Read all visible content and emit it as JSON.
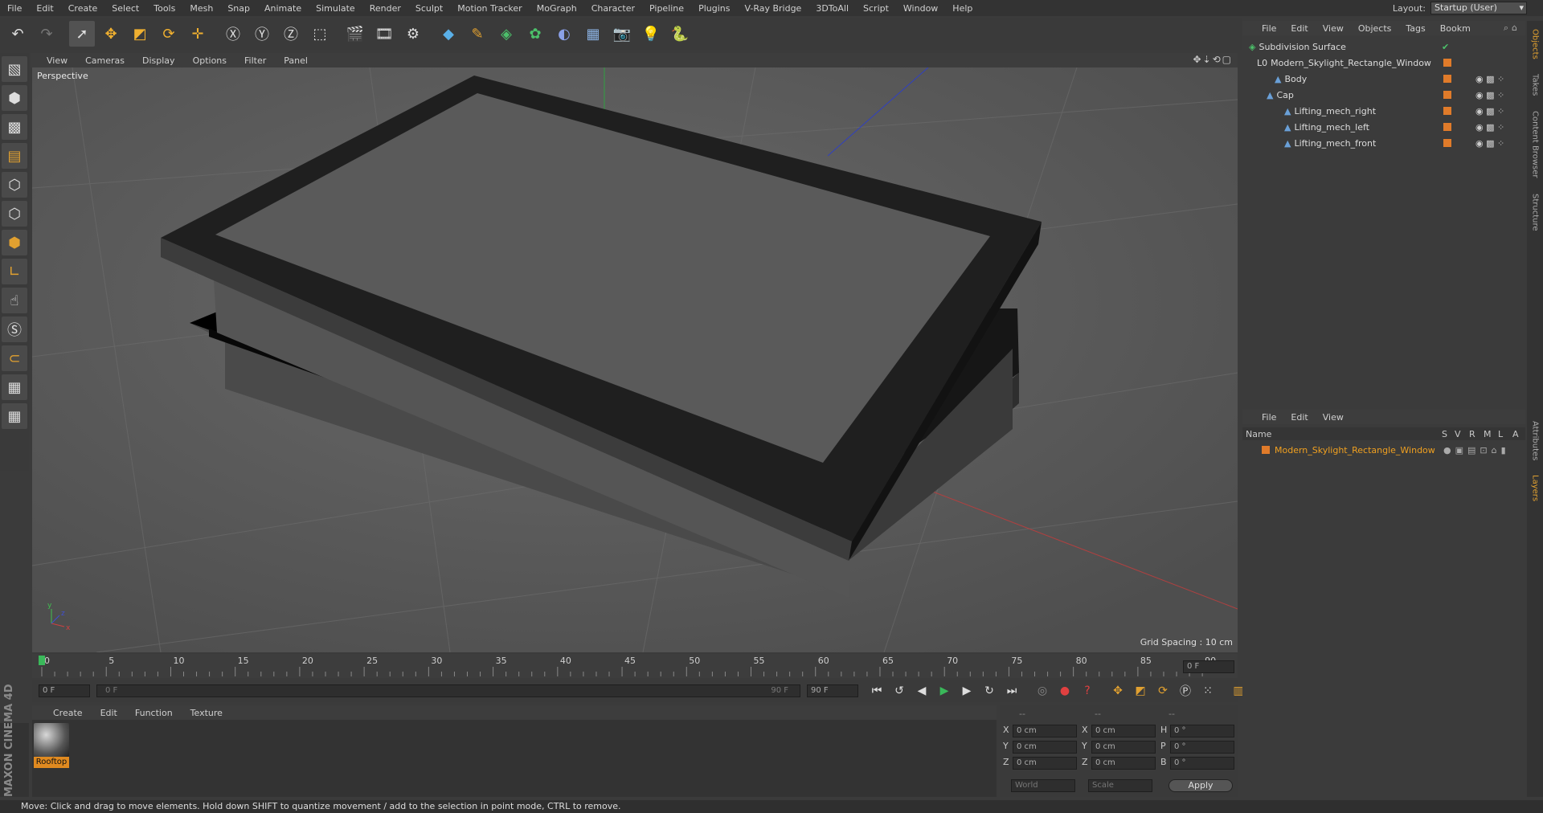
{
  "menubar": {
    "items": [
      "File",
      "Edit",
      "Create",
      "Select",
      "Tools",
      "Mesh",
      "Snap",
      "Animate",
      "Simulate",
      "Render",
      "Sculpt",
      "Motion Tracker",
      "MoGraph",
      "Character",
      "Pipeline",
      "Plugins",
      "V-Ray Bridge",
      "3DToAll",
      "Script",
      "Window",
      "Help"
    ],
    "layout_label": "Layout:",
    "layout_value": "Startup (User)"
  },
  "viewport": {
    "menu": [
      "View",
      "Cameras",
      "Display",
      "Options",
      "Filter",
      "Panel"
    ],
    "label": "Perspective",
    "grid_spacing": "Grid Spacing : 10 cm"
  },
  "timeline": {
    "ticks": [
      "0",
      "5",
      "10",
      "15",
      "20",
      "25",
      "30",
      "35",
      "40",
      "45",
      "50",
      "55",
      "60",
      "65",
      "70",
      "75",
      "80",
      "85",
      "90"
    ],
    "current_frame": "0 F"
  },
  "transport": {
    "start": "0 F",
    "range_start": "0 F",
    "range_end": "90 F",
    "end": "90 F"
  },
  "material_manager": {
    "menu": [
      "Create",
      "Edit",
      "Function",
      "Texture"
    ],
    "material_name": "Rooftop"
  },
  "coords": {
    "headers": [
      "--",
      "--",
      "--"
    ],
    "rows": [
      {
        "a": "X",
        "av": "0 cm",
        "b": "X",
        "bv": "0 cm",
        "c": "H",
        "cv": "0 °"
      },
      {
        "a": "Y",
        "av": "0 cm",
        "b": "Y",
        "bv": "0 cm",
        "c": "P",
        "cv": "0 °"
      },
      {
        "a": "Z",
        "av": "0 cm",
        "b": "Z",
        "bv": "0 cm",
        "c": "B",
        "cv": "0 °"
      }
    ],
    "world": "World",
    "scale": "Scale",
    "apply": "Apply"
  },
  "object_manager": {
    "menu": [
      "File",
      "Edit",
      "View",
      "Objects",
      "Tags",
      "Bookm"
    ],
    "items": [
      {
        "name": "Subdivision Surface"
      },
      {
        "name": "Modern_Skylight_Rectangle_Window"
      },
      {
        "name": "Body"
      },
      {
        "name": "Cap"
      },
      {
        "name": "Lifting_mech_right"
      },
      {
        "name": "Lifting_mech_left"
      },
      {
        "name": "Lifting_mech_front"
      }
    ]
  },
  "layer_manager": {
    "menu": [
      "File",
      "Edit",
      "View"
    ],
    "col_name": "Name",
    "cols": [
      "S",
      "V",
      "R",
      "M",
      "L",
      "A"
    ],
    "item": "Modern_Skylight_Rectangle_Window"
  },
  "right_tabs": [
    "Objects",
    "Takes",
    "Content Browser",
    "Structure",
    "Attributes",
    "Layers"
  ],
  "brand": "MAXON CINEMA 4D",
  "status": "Move: Click and drag to move elements. Hold down SHIFT to quantize movement / add to the selection in point mode, CTRL to remove.",
  "colors": {
    "accent": "#e07b2a",
    "selected_text": "#f0a020",
    "timeline_marker": "#3ab85a"
  }
}
